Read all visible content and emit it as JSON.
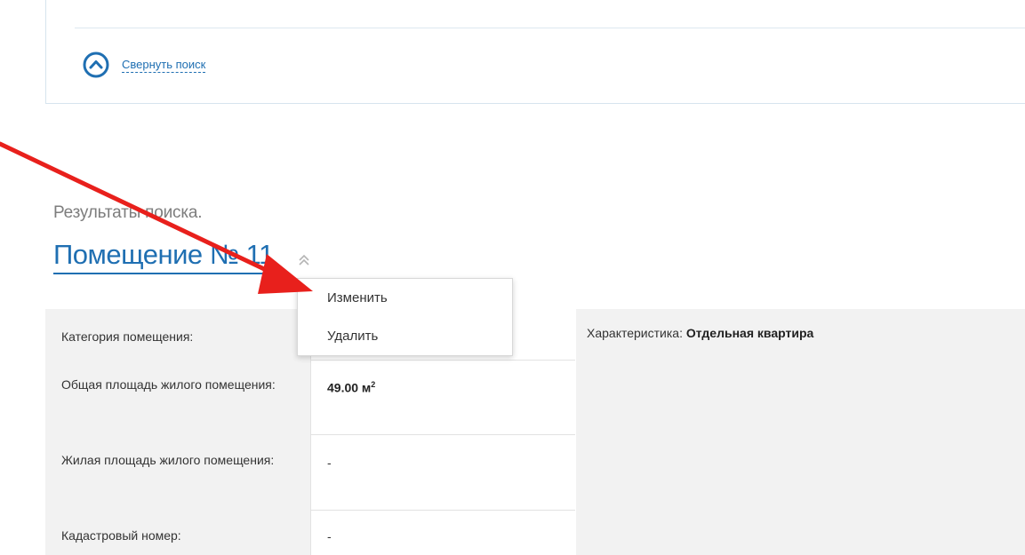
{
  "search_panel": {
    "collapse_label": "Свернуть поиск",
    "collapse_icon": "chevron-up-circle-icon"
  },
  "results": {
    "caption": "Результаты поиска.",
    "title": "Помещение № 11",
    "title_icon": "double-chevron-up-icon"
  },
  "context_menu": {
    "items": [
      "Изменить",
      "Удалить"
    ]
  },
  "details": {
    "rows": [
      {
        "label": "Категория помещения:",
        "value": ""
      },
      {
        "label": "Общая площадь жилого помещения:",
        "value": "49.00 м",
        "value_sup": "2"
      },
      {
        "label": "Жилая площадь жилого помещения:",
        "value": "-"
      },
      {
        "label": "Кадастровый номер:",
        "value": "-"
      }
    ],
    "side_label": "Характеристика:",
    "side_value": "Отдельная квартира"
  },
  "colors": {
    "accent": "#1f6fb2",
    "annotation_arrow": "#e8201c",
    "label_bg": "#f2f2f2"
  }
}
